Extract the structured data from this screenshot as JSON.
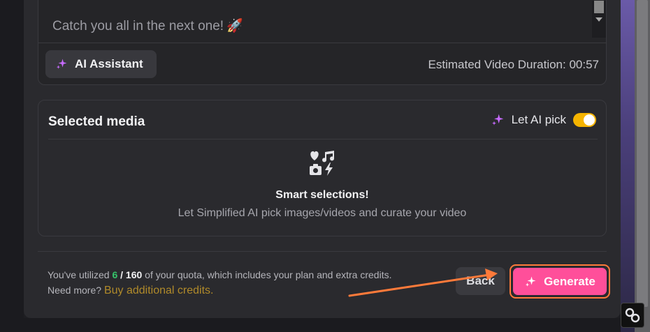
{
  "script": {
    "text": "Catch you all in the next one!",
    "rocket": "🚀"
  },
  "ai_assistant": {
    "label": "AI Assistant"
  },
  "duration": {
    "text": "Estimated Video Duration: 00:57"
  },
  "media": {
    "title": "Selected media",
    "let_ai_label": "Let AI pick",
    "let_ai_on": true,
    "smart_title": "Smart selections!",
    "smart_desc": "Let Simplified AI pick images/videos and curate your video"
  },
  "quota": {
    "prefix": "You've utilized ",
    "used": "6",
    "sep": " / ",
    "total": "160",
    "suffix": " of your quota, which includes your plan and extra credits.",
    "need_more": "Need more? ",
    "buy_link": "Buy additional credits."
  },
  "actions": {
    "back_label": "Back",
    "generate_label": "Generate"
  },
  "colors": {
    "accent_pink": "#ff4f9a",
    "toggle_on": "#f5b400",
    "used_green": "#36c46a",
    "sparkle": "#c86bff"
  },
  "icons": {
    "sparkle": "sparkle-icon",
    "smart": "media-collage-icon",
    "badge": "link-icon"
  }
}
